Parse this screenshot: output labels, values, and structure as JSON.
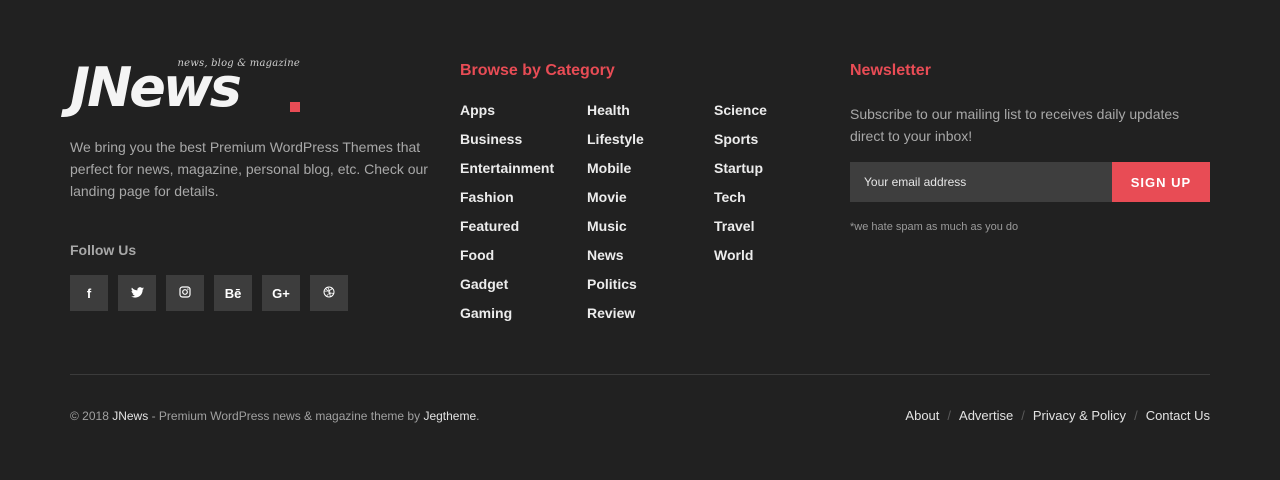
{
  "brand": {
    "logo_word": "JNews",
    "logo_tagline": "news, blog & magazine",
    "accent_color": "#e84c55"
  },
  "about": {
    "text": "We bring you the best Premium WordPress Themes that perfect for news, magazine, personal blog, etc. Check our landing page for details.",
    "follow_title": "Follow Us",
    "socials": [
      {
        "icon": "facebook-icon",
        "glyph": "f"
      },
      {
        "icon": "twitter-icon",
        "glyph": "🐦"
      },
      {
        "icon": "instagram-icon",
        "glyph": "◎"
      },
      {
        "icon": "behance-icon",
        "glyph": "Bē"
      },
      {
        "icon": "google-plus-icon",
        "glyph": "G+"
      },
      {
        "icon": "dribbble-icon",
        "glyph": "◍"
      }
    ]
  },
  "categories": {
    "title": "Browse by Category",
    "columns": [
      [
        "Apps",
        "Business",
        "Entertainment",
        "Fashion",
        "Featured",
        "Food",
        "Gadget",
        "Gaming"
      ],
      [
        "Health",
        "Lifestyle",
        "Mobile",
        "Movie",
        "Music",
        "News",
        "Politics",
        "Review"
      ],
      [
        "Science",
        "Sports",
        "Startup",
        "Tech",
        "Travel",
        "World"
      ]
    ]
  },
  "newsletter": {
    "title": "Newsletter",
    "text": "Subscribe to our mailing list to receives daily updates direct to your inbox!",
    "input_placeholder": "Your email address",
    "button_label": "SIGN UP",
    "note": "*we hate spam as much as you do"
  },
  "bottom": {
    "copyright_prefix": "© 2018 ",
    "copyright_brand": "JNews",
    "copyright_middle": " - Premium WordPress news & magazine theme by ",
    "copyright_author": "Jegtheme",
    "copyright_suffix": ".",
    "links": [
      "About",
      "Advertise",
      "Privacy & Policy",
      "Contact Us"
    ],
    "separator": "/"
  }
}
